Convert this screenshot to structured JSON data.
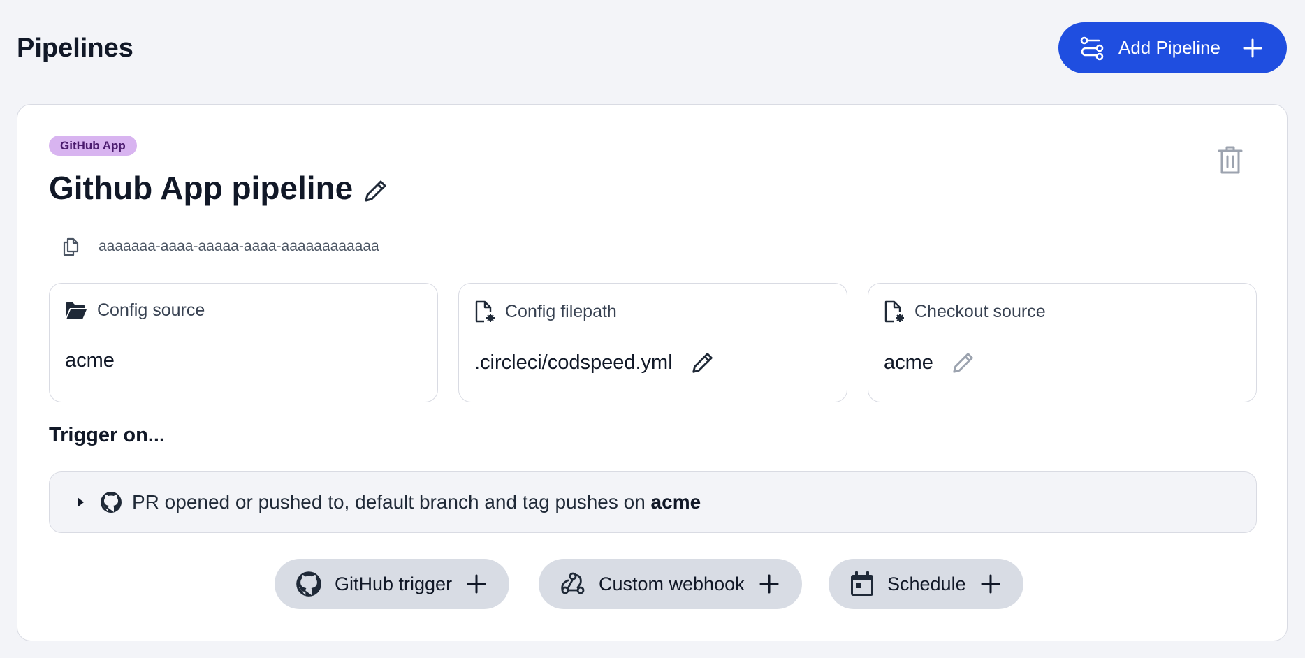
{
  "header": {
    "title": "Pipelines",
    "add_button_label": "Add Pipeline"
  },
  "pipeline": {
    "badge": "GitHub App",
    "title": "Github App pipeline",
    "id": "aaaaaaa-aaaa-aaaaa-aaaa-aaaaaaaaaaaa",
    "info": {
      "config_source": {
        "label": "Config source",
        "value": "acme"
      },
      "config_filepath": {
        "label": "Config filepath",
        "value": ".circleci/codspeed.yml"
      },
      "checkout_source": {
        "label": "Checkout source",
        "value": "acme"
      }
    },
    "triggers_title": "Trigger on...",
    "trigger": {
      "text": "PR opened or pushed to, default branch and tag pushes on ",
      "repo": "acme"
    },
    "add_trigger_buttons": {
      "github": "GitHub trigger",
      "webhook": "Custom webhook",
      "schedule": "Schedule"
    }
  },
  "colors": {
    "primary": "#1f4ee0",
    "badge_bg": "#d8b4f0",
    "badge_text": "#4b1b6e",
    "page_bg": "#f3f4f8"
  },
  "icons": [
    "pipeline-icon",
    "plus-icon",
    "pencil-icon",
    "trash-icon",
    "copy-icon",
    "folder-open-icon",
    "file-gear-icon",
    "caret-right-icon",
    "github-icon",
    "webhook-icon",
    "calendar-icon"
  ]
}
